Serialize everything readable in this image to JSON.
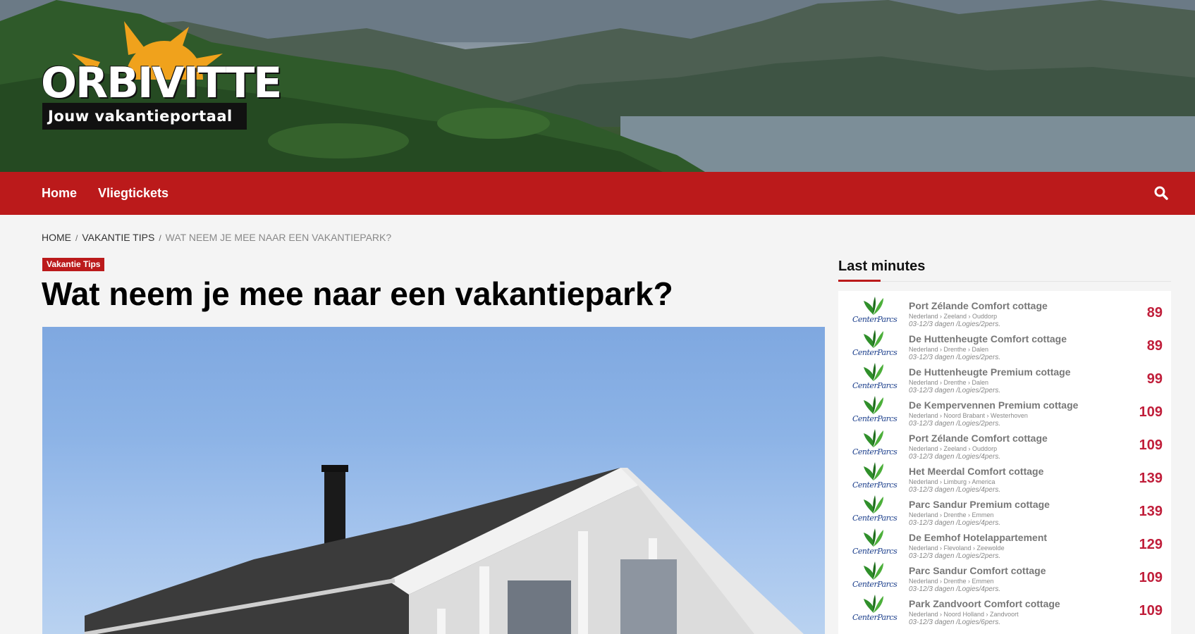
{
  "header": {
    "logo_word": "ORBIVITTE",
    "logo_tagline": "Jouw vakantieportaal"
  },
  "nav": {
    "items": [
      "Home",
      "Vliegtickets"
    ],
    "search_icon": "search-icon"
  },
  "breadcrumb": {
    "home": "Home",
    "category": "Vakantie Tips",
    "current": "Wat neem je mee naar een vakantiepark?"
  },
  "article": {
    "category_badge": "Vakantie Tips",
    "title": "Wat neem je mee naar een vakantiepark?"
  },
  "sidebar": {
    "title": "Last minutes",
    "brand": "CenterParcs",
    "items": [
      {
        "name": "Port Zélande Comfort cottage",
        "location": "Nederland › Zeeland › Ouddorp",
        "dates": "03-12/3 dagen /Logies/2pers.",
        "price": "89"
      },
      {
        "name": "De Huttenheugte Comfort cottage",
        "location": "Nederland › Drenthe › Dalen",
        "dates": "03-12/3 dagen /Logies/2pers.",
        "price": "89"
      },
      {
        "name": "De Huttenheugte Premium cottage",
        "location": "Nederland › Drenthe › Dalen",
        "dates": "03-12/3 dagen /Logies/2pers.",
        "price": "99"
      },
      {
        "name": "De Kempervennen Premium cottage",
        "location": "Nederland › Noord Brabant › Westerhoven",
        "dates": "03-12/3 dagen /Logies/2pers.",
        "price": "109"
      },
      {
        "name": "Port Zélande Comfort cottage",
        "location": "Nederland › Zeeland › Ouddorp",
        "dates": "03-12/3 dagen /Logies/4pers.",
        "price": "109"
      },
      {
        "name": "Het Meerdal Comfort cottage",
        "location": "Nederland › Limburg › America",
        "dates": "03-12/3 dagen /Logies/4pers.",
        "price": "139"
      },
      {
        "name": "Parc Sandur Premium cottage",
        "location": "Nederland › Drenthe › Emmen",
        "dates": "03-12/3 dagen /Logies/4pers.",
        "price": "139"
      },
      {
        "name": "De Eemhof Hotelappartement",
        "location": "Nederland › Flevoland › Zeewolde",
        "dates": "03-12/3 dagen /Logies/2pers.",
        "price": "129"
      },
      {
        "name": "Parc Sandur Comfort cottage",
        "location": "Nederland › Drenthe › Emmen",
        "dates": "03-12/3 dagen /Logies/4pers.",
        "price": "109"
      },
      {
        "name": "Park Zandvoort Comfort cottage",
        "location": "Nederland › Noord Holland › Zandvoort",
        "dates": "03-12/3 dagen /Logies/6pers.",
        "price": "109"
      }
    ]
  },
  "colors": {
    "nav_red": "#bb1a1b",
    "price_red": "#c01e3a",
    "logo_sun": "#f0a21c"
  }
}
